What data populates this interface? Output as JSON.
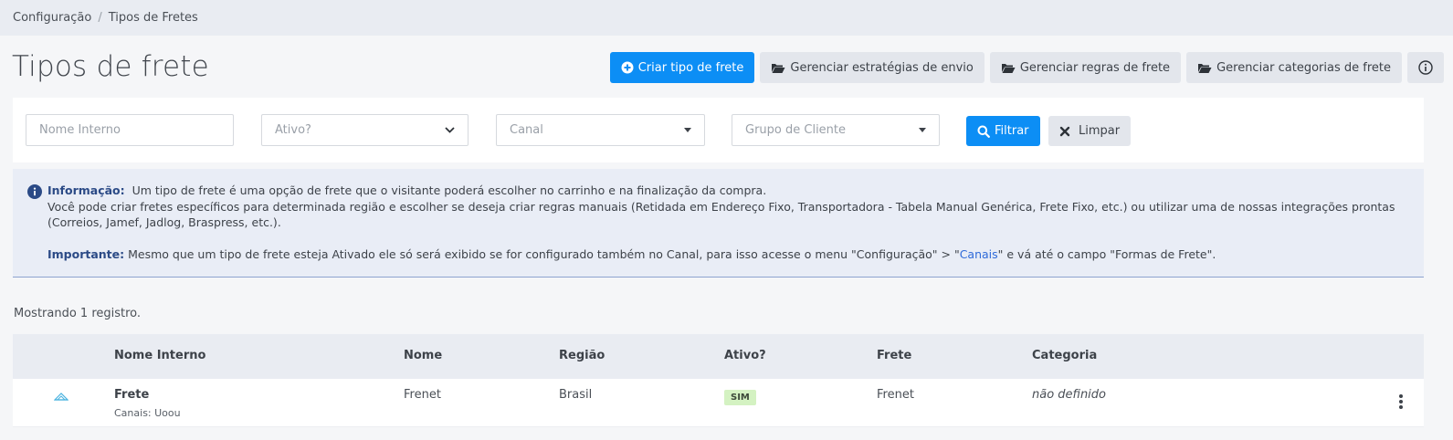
{
  "breadcrumb": {
    "items": [
      "Configuração",
      "Tipos de Fretes"
    ],
    "separator": "/"
  },
  "page": {
    "title": "Tipos de frete"
  },
  "actions": {
    "create": "Criar tipo de frete",
    "strategies": "Gerenciar estratégias de envio",
    "rules": "Gerenciar regras de frete",
    "categories": "Gerenciar categorias de frete",
    "info_icon": "info-circle-icon"
  },
  "filters": {
    "nome_placeholder": "Nome Interno",
    "ativo_placeholder": "Ativo?",
    "canal_placeholder": "Canal",
    "grupo_placeholder": "Grupo de Cliente",
    "filter_button": "Filtrar",
    "clear_button": "Limpar"
  },
  "info": {
    "label": "Informação:",
    "line1": "Um tipo de frete é uma opção de frete que o visitante poderá escolher no carrinho e na finalização da compra.",
    "line2": "Você pode criar fretes específicos para determinada região e escolher se deseja criar regras manuais (Retidada em Endereço Fixo, Transportadora - Tabela Manual Genérica, Frete Fixo, etc.) ou utilizar uma de nossas integrações prontas (Correios, Jamef, Jadlog, Braspress, etc.).",
    "important_label": "Importante:",
    "important_pre": "Mesmo que um tipo de frete esteja Ativado ele só será exibido se for configurado também no Canal, para isso acesse o menu \"Configuração\" > \"",
    "important_link": "Canais",
    "important_post": "\" e vá até o campo \"Formas de Frete\"."
  },
  "results": {
    "count_text": "Mostrando 1 registro."
  },
  "table": {
    "headers": {
      "nome_interno": "Nome Interno",
      "nome": "Nome",
      "regiao": "Região",
      "ativo": "Ativo?",
      "frete": "Frete",
      "categoria": "Categoria"
    },
    "rows": [
      {
        "nome_interno": "Frete",
        "canais": "Canais: Uoou",
        "nome": "Frenet",
        "regiao": "Brasil",
        "ativo": "SIM",
        "frete": "Frenet",
        "categoria": "não definido"
      }
    ]
  },
  "colors": {
    "primary": "#0c8ef5",
    "badge_green": "#d4f2c2",
    "info_bg": "#e9edf6",
    "link": "#2f6ad9"
  }
}
